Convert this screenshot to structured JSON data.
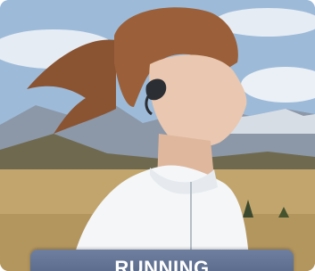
{
  "card": {
    "mode_label": "RUNNING",
    "image_icon": "photo-of-runner-with-earbud"
  },
  "colors": {
    "label_bg": "#5f6f90",
    "label_text": "#ffffff"
  }
}
